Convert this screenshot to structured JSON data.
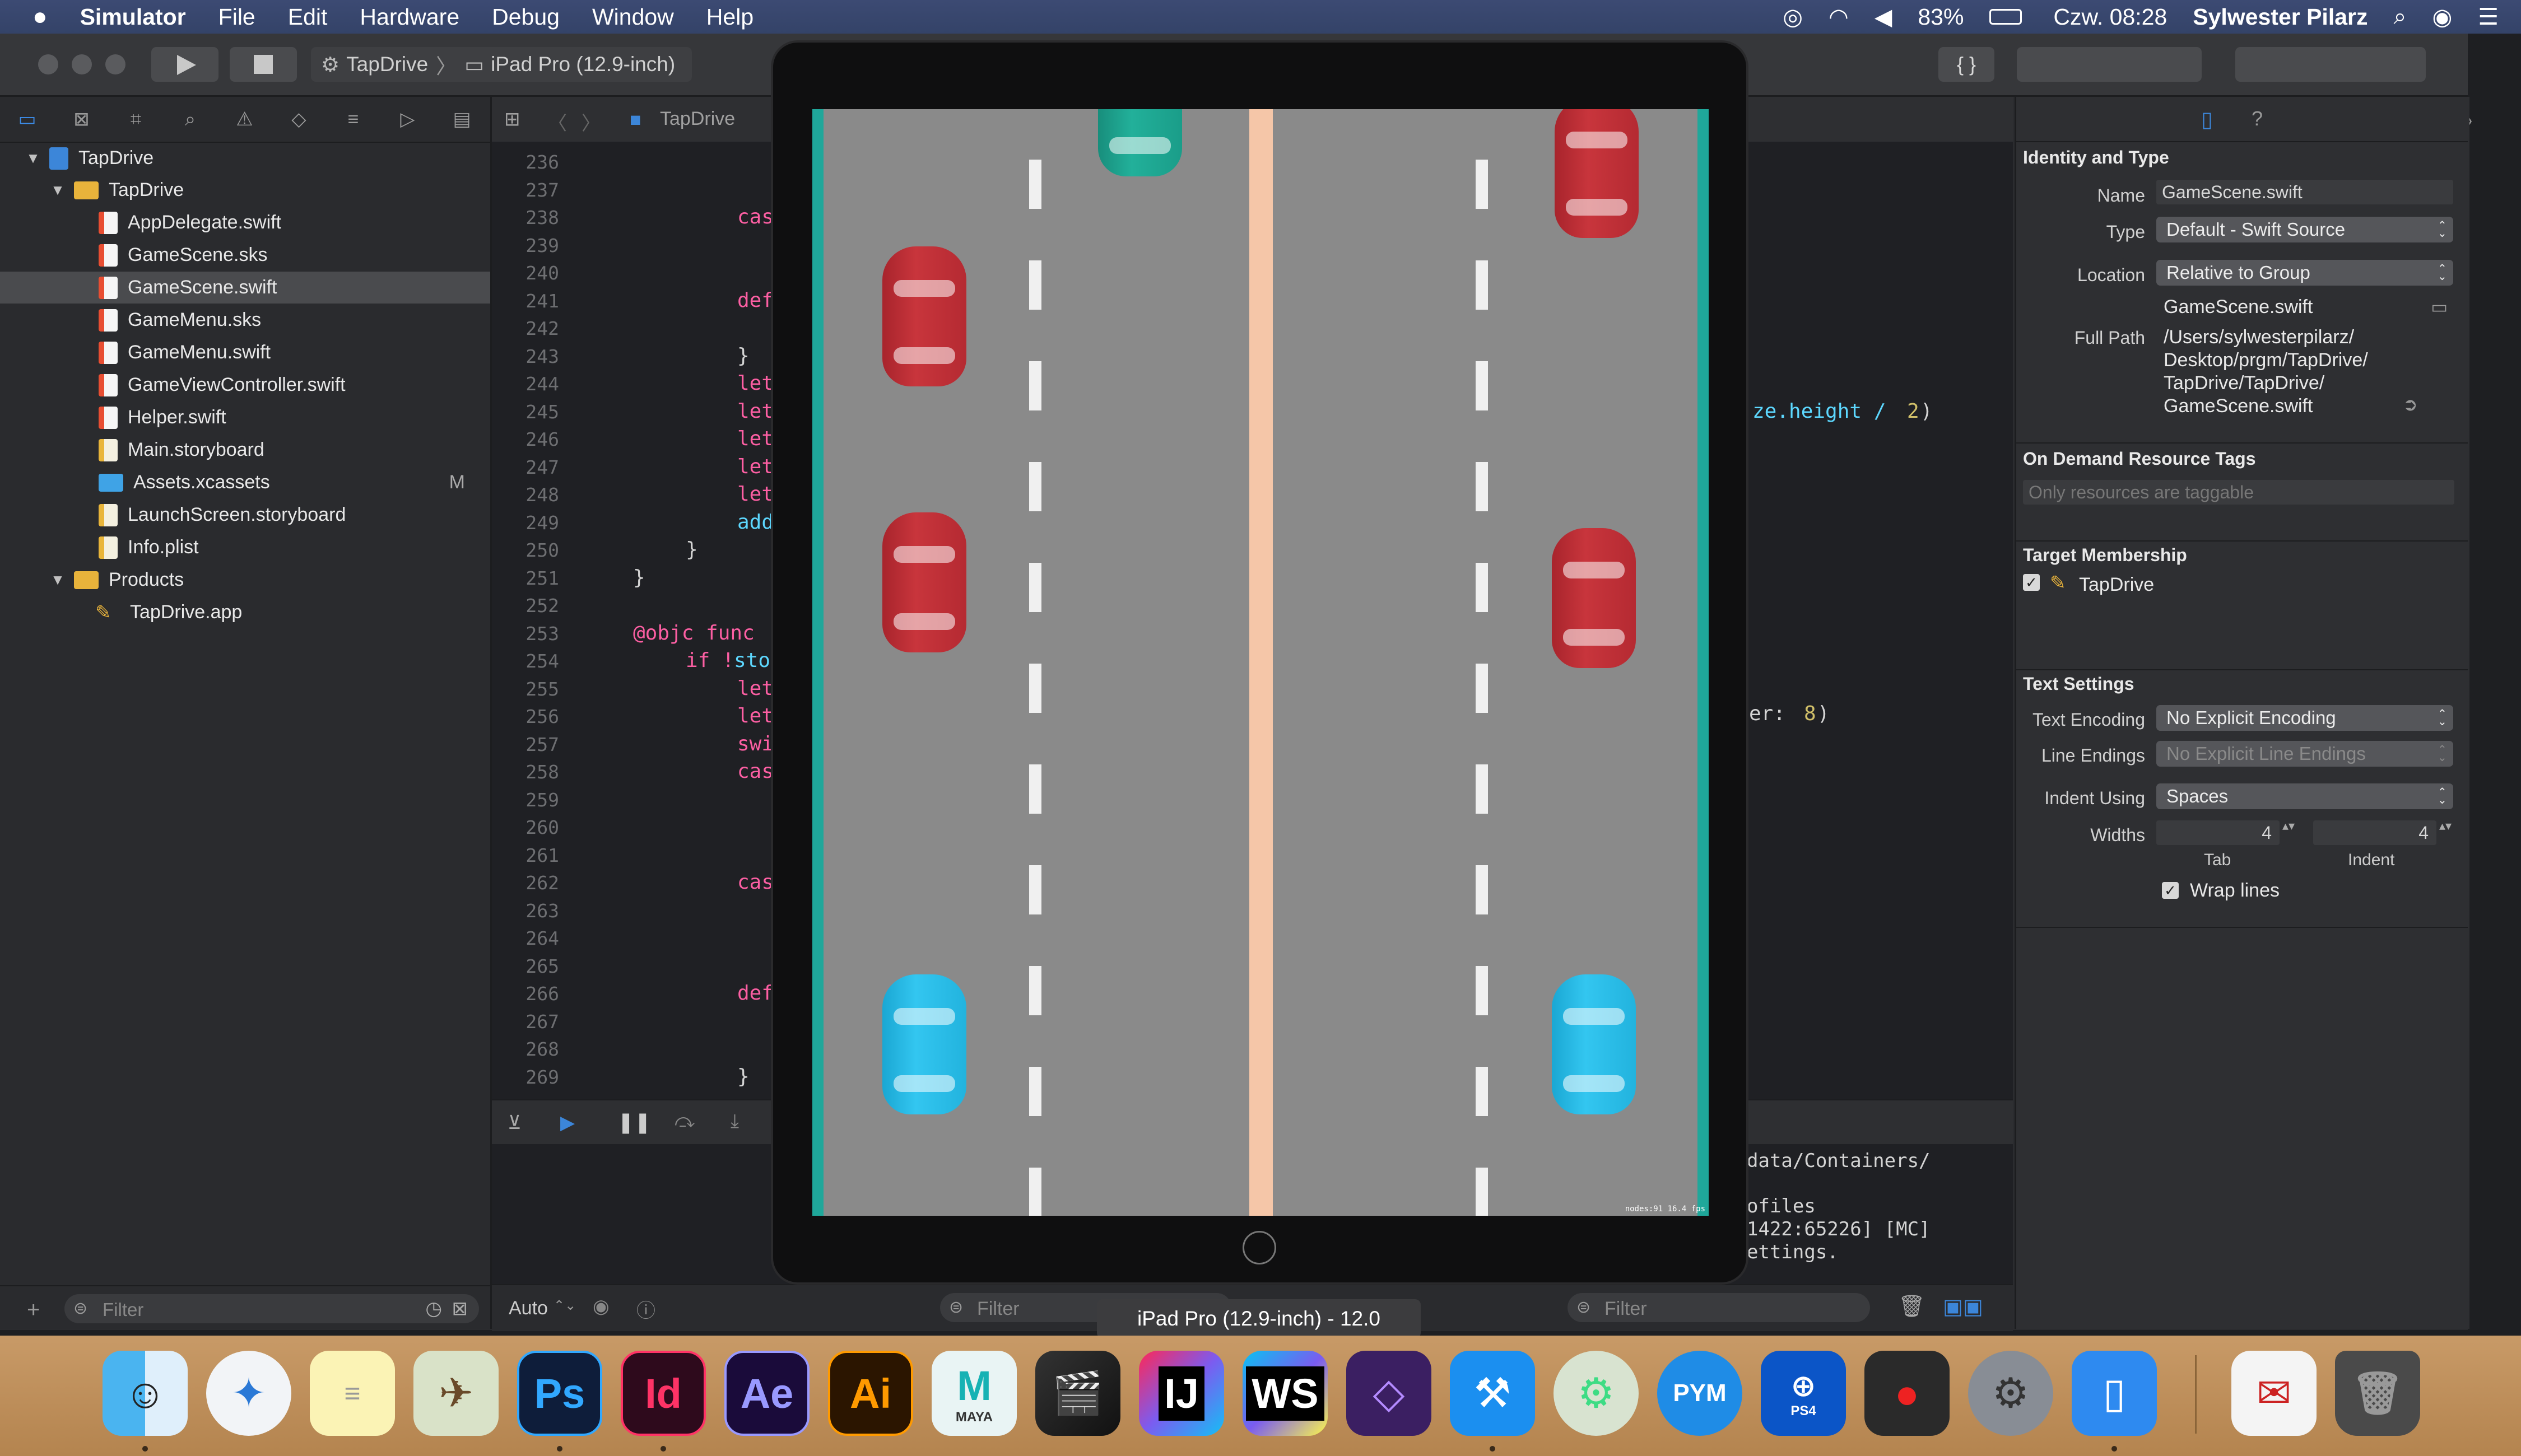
{
  "menubar": {
    "app": "Simulator",
    "items": [
      "File",
      "Edit",
      "Hardware",
      "Debug",
      "Window",
      "Help"
    ],
    "battery": "83%",
    "clock": "Czw. 08:28",
    "user": "Sylwester Pilarz"
  },
  "toolbar": {
    "scheme": "TapDrive",
    "device": "iPad Pro (12.9-inch)"
  },
  "navigator": {
    "items": [
      {
        "label": "TapDrive",
        "icon": "project-icon",
        "level": 0,
        "open": true
      },
      {
        "label": "TapDrive",
        "icon": "folder-icon",
        "level": 1,
        "open": true
      },
      {
        "label": "AppDelegate.swift",
        "icon": "swift-file-icon",
        "level": 2
      },
      {
        "label": "GameScene.sks",
        "icon": "sks-file-icon",
        "level": 2
      },
      {
        "label": "GameScene.swift",
        "icon": "swift-file-icon",
        "level": 2,
        "selected": true
      },
      {
        "label": "GameMenu.sks",
        "icon": "sks-file-icon",
        "level": 2
      },
      {
        "label": "GameMenu.swift",
        "icon": "swift-file-icon",
        "level": 2
      },
      {
        "label": "GameViewController.swift",
        "icon": "swift-file-icon",
        "level": 2
      },
      {
        "label": "Helper.swift",
        "icon": "swift-file-icon",
        "level": 2
      },
      {
        "label": "Main.storyboard",
        "icon": "storyboard-icon",
        "level": 2
      },
      {
        "label": "Assets.xcassets",
        "icon": "assets-folder-icon",
        "level": 2,
        "badge": "M"
      },
      {
        "label": "LaunchScreen.storyboard",
        "icon": "storyboard-icon",
        "level": 2
      },
      {
        "label": "Info.plist",
        "icon": "plist-icon",
        "level": 2
      },
      {
        "label": "Products",
        "icon": "folder-icon",
        "level": 1,
        "open": true
      },
      {
        "label": "TapDrive.app",
        "icon": "app-icon",
        "level": 2
      }
    ],
    "filter_placeholder": "Filter"
  },
  "jumpbar": {
    "path": "TapDrive"
  },
  "editor": {
    "line_numbers": [
      "236",
      "237",
      "238",
      "239",
      "240",
      "241",
      "242",
      "243",
      "244",
      "245",
      "246",
      "247",
      "248",
      "249",
      "250",
      "251",
      "252",
      "253",
      "254",
      "255",
      "256",
      "257",
      "258",
      "259",
      "260",
      "261",
      "262",
      "263",
      "264",
      "265",
      "266",
      "267",
      "268",
      "269"
    ],
    "code": {
      "l238": "cas",
      "l241": "def",
      "l243": "}",
      "l244": "let",
      "l245": "let",
      "l246": "let",
      "l247": "let",
      "l248": "let",
      "l249": "add",
      "l250": "}",
      "l251": "}",
      "l253": "@objc func",
      "l254a": "if !",
      "l254b": "sto",
      "l255": "let",
      "l256": "let",
      "l257": "swi",
      "l258": "cas",
      "l262": "cas",
      "l266": "def",
      "l269": "}",
      "right245a": "ze.height / ",
      "right245b": "2",
      "right245c": ")",
      "right257a": "er: ",
      "right257b": "8",
      "right257c": ")"
    }
  },
  "debug": {
    "console_lines": [
      "data/Containers/",
      "",
      "ofiles",
      "1422:65226] [MC]",
      "ettings."
    ],
    "auto_label": "Auto",
    "filter_left": "Filter",
    "filter_right": "Filter"
  },
  "inspector": {
    "identity_title": "Identity and Type",
    "name_label": "Name",
    "name_value": "GameScene.swift",
    "type_label": "Type",
    "type_value": "Default - Swift Source",
    "location_label": "Location",
    "location_value": "Relative to Group",
    "location_file": "GameScene.swift",
    "fullpath_label": "Full Path",
    "fullpath_lines": [
      "/Users/sylwesterpilarz/",
      "Desktop/prgm/TapDrive/",
      "TapDrive/TapDrive/",
      "GameScene.swift"
    ],
    "ondemand_title": "On Demand Resource Tags",
    "ondemand_placeholder": "Only resources are taggable",
    "target_title": "Target Membership",
    "target_name": "TapDrive",
    "text_title": "Text Settings",
    "encoding_label": "Text Encoding",
    "encoding_value": "No Explicit Encoding",
    "line_endings_label": "Line Endings",
    "line_endings_value": "No Explicit Line Endings",
    "indent_label": "Indent Using",
    "indent_value": "Spaces",
    "widths_label": "Widths",
    "tab_value": "4",
    "indent_width_value": "4",
    "tab_caption": "Tab",
    "indent_caption": "Indent",
    "wrap_label": "Wrap lines"
  },
  "simulator": {
    "tooltip": "iPad Pro (12.9-inch) - 12.0",
    "fps_label": "nodes:91  16.4 fps",
    "road_color": "#8a8a8a",
    "edge_color": "#1fa79a",
    "median_color": "#f5c6a8"
  },
  "dock": {
    "apps": [
      {
        "name": "finder-icon",
        "label": ""
      },
      {
        "name": "safari-icon",
        "label": ""
      },
      {
        "name": "notes-icon",
        "label": ""
      },
      {
        "name": "preview-icon",
        "label": ""
      },
      {
        "name": "photoshop-icon",
        "label": "Ps"
      },
      {
        "name": "indesign-icon",
        "label": "Id"
      },
      {
        "name": "after-effects-icon",
        "label": "Ae"
      },
      {
        "name": "illustrator-icon",
        "label": "Ai"
      },
      {
        "name": "maya-icon",
        "label": "M"
      },
      {
        "name": "final-cut-icon",
        "label": ""
      },
      {
        "name": "intellij-icon",
        "label": "IJ"
      },
      {
        "name": "webstorm-icon",
        "label": "WS"
      },
      {
        "name": "visual-studio-icon",
        "label": ""
      },
      {
        "name": "xcode-icon",
        "label": ""
      },
      {
        "name": "android-studio-icon",
        "label": ""
      },
      {
        "name": "pym-player-icon",
        "label": "PYM"
      },
      {
        "name": "ps4-remote-icon",
        "label": ""
      },
      {
        "name": "joystick-icon",
        "label": ""
      },
      {
        "name": "system-preferences-icon",
        "label": ""
      },
      {
        "name": "simulator-icon",
        "label": ""
      },
      {
        "name": "document-icon",
        "label": ""
      },
      {
        "name": "trash-icon",
        "label": ""
      }
    ],
    "maya_caption": "MAYA",
    "ps4_caption": "PS4"
  }
}
